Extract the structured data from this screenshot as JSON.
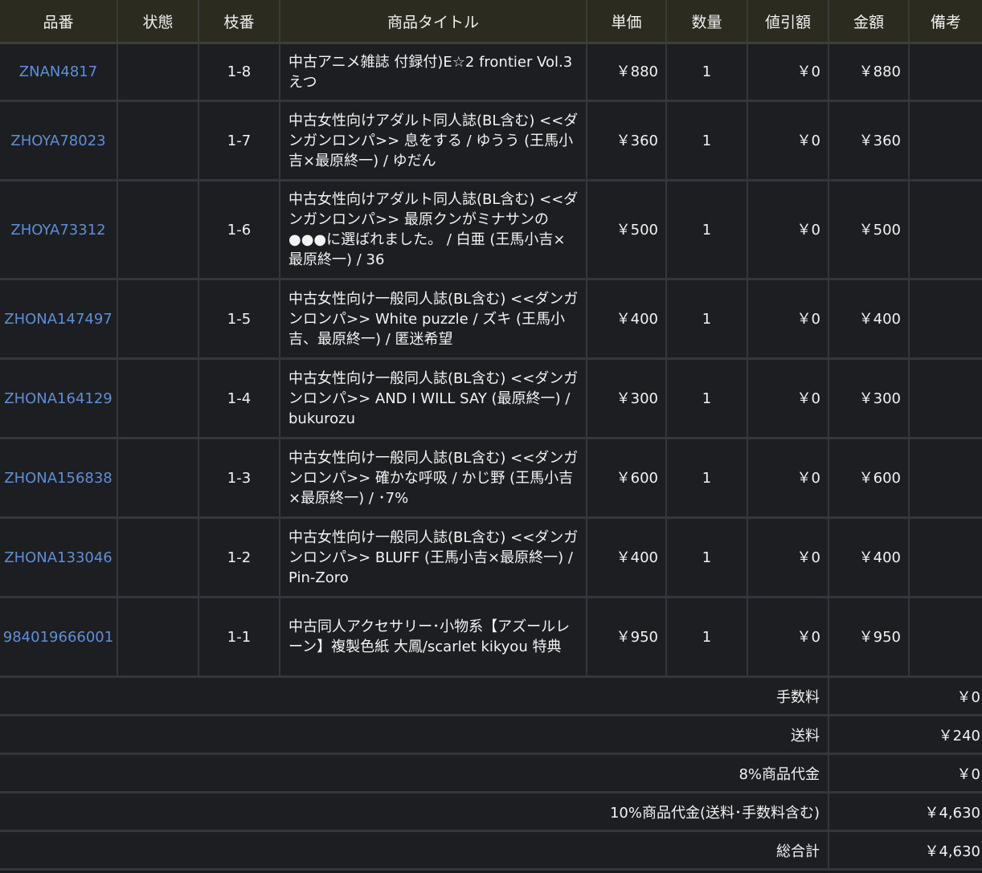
{
  "headers": [
    "品番",
    "状態",
    "枝番",
    "商品タイトル",
    "単価",
    "数量",
    "値引額",
    "金額",
    "備考"
  ],
  "rows": [
    {
      "code": "ZNAN4817",
      "status": "",
      "branch": "1-8",
      "title": "中古アニメ雑誌 付録付)E☆2 frontier Vol.3 えつ",
      "price": "￥880",
      "qty": "1",
      "discount": "￥0",
      "amount": "￥880",
      "note": ""
    },
    {
      "code": "ZHOYA78023",
      "status": "",
      "branch": "1-7",
      "title": "中古女性向けアダルト同人誌(BL含む) <<ダンガンロンパ>> 息をする / ゆうう (王馬小吉×最原終一) / ゆだん",
      "price": "￥360",
      "qty": "1",
      "discount": "￥0",
      "amount": "￥360",
      "note": ""
    },
    {
      "code": "ZHOYA73312",
      "status": "",
      "branch": "1-6",
      "title": "中古女性向けアダルト同人誌(BL含む) <<ダンガンロンパ>> 最原クンがミナサンの●●●に選ばれました。 / 白亜 (王馬小吉×最原終一) / 36",
      "price": "￥500",
      "qty": "1",
      "discount": "￥0",
      "amount": "￥500",
      "note": ""
    },
    {
      "code": "ZHONA147497",
      "status": "",
      "branch": "1-5",
      "title": "中古女性向け一般同人誌(BL含む) <<ダンガンロンパ>> White puzzle / ズキ (王馬小吉、最原終一) / 匿迷希望",
      "price": "￥400",
      "qty": "1",
      "discount": "￥0",
      "amount": "￥400",
      "note": ""
    },
    {
      "code": "ZHONA164129",
      "status": "",
      "branch": "1-4",
      "title": "中古女性向け一般同人誌(BL含む) <<ダンガンロンパ>> AND I WILL SAY (最原終一) / bukurozu",
      "price": "￥300",
      "qty": "1",
      "discount": "￥0",
      "amount": "￥300",
      "note": ""
    },
    {
      "code": "ZHONA156838",
      "status": "",
      "branch": "1-3",
      "title": "中古女性向け一般同人誌(BL含む) <<ダンガンロンパ>> 確かな呼吸 / かじ野 (王馬小吉×最原終一) / ･7%",
      "price": "￥600",
      "qty": "1",
      "discount": "￥0",
      "amount": "￥600",
      "note": ""
    },
    {
      "code": "ZHONA133046",
      "status": "",
      "branch": "1-2",
      "title": "中古女性向け一般同人誌(BL含む) <<ダンガンロンパ>> BLUFF (王馬小吉×最原終一) / Pin-Zoro",
      "price": "￥400",
      "qty": "1",
      "discount": "￥0",
      "amount": "￥400",
      "note": ""
    },
    {
      "code": "984019666001",
      "status": "",
      "branch": "1-1",
      "title": "中古同人アクセサリー･小物系【アズールレーン】複製色紙 大鳳/scarlet kikyou 特典",
      "price": "￥950",
      "qty": "1",
      "discount": "￥0",
      "amount": "￥950",
      "note": ""
    }
  ],
  "summary": [
    {
      "label": "手数料",
      "value": "￥0"
    },
    {
      "label": "送料",
      "value": "￥240"
    },
    {
      "label": "8%商品代金",
      "value": "￥0"
    },
    {
      "label": "10%商品代金(送料･手数料含む)",
      "value": "￥4,630"
    },
    {
      "label": "総合計",
      "value": "￥4,630"
    }
  ]
}
